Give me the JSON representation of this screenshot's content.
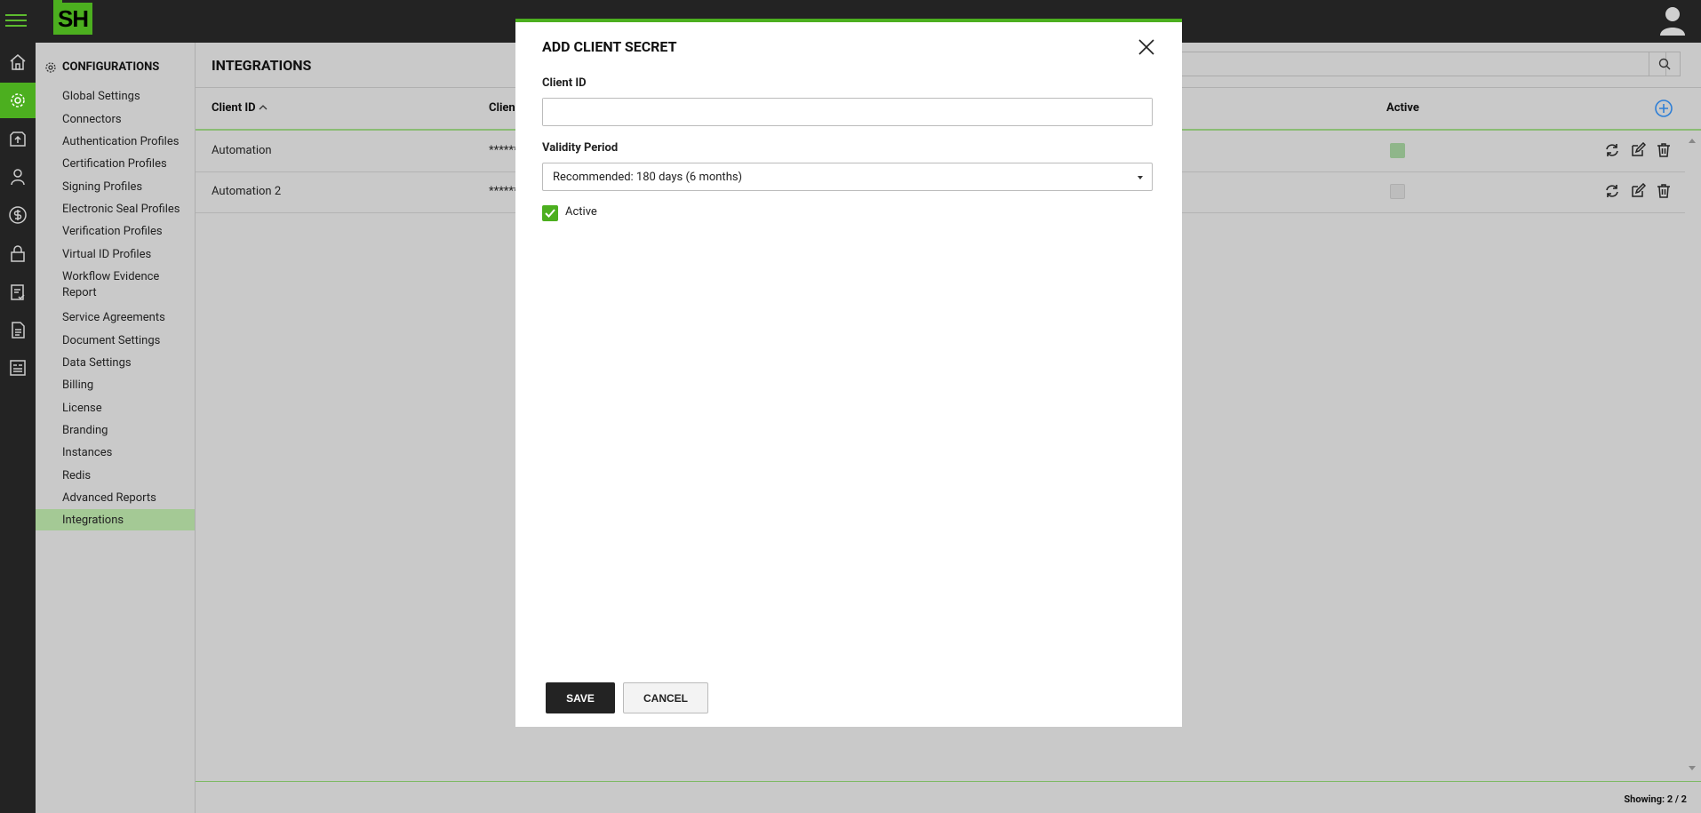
{
  "app": {
    "logo_text": "SH"
  },
  "sidebar": {
    "title": "CONFIGURATIONS",
    "items": [
      {
        "label": "Global Settings"
      },
      {
        "label": "Connectors"
      },
      {
        "label": "Authentication Profiles"
      },
      {
        "label": "Certification Profiles"
      },
      {
        "label": "Signing Profiles"
      },
      {
        "label": "Electronic Seal Profiles"
      },
      {
        "label": "Verification Profiles"
      },
      {
        "label": "Virtual ID Profiles"
      },
      {
        "label": "Workflow Evidence Report"
      },
      {
        "label": "Service Agreements"
      },
      {
        "label": "Document Settings"
      },
      {
        "label": "Data Settings"
      },
      {
        "label": "Billing"
      },
      {
        "label": "License"
      },
      {
        "label": "Branding"
      },
      {
        "label": "Instances"
      },
      {
        "label": "Redis"
      },
      {
        "label": "Advanced Reports"
      },
      {
        "label": "Integrations"
      }
    ]
  },
  "main": {
    "title": "INTEGRATIONS",
    "search_placeholder": "Search",
    "columns": {
      "client_id": "Client ID",
      "client_secret": "Clien",
      "active": "Active"
    },
    "rows": [
      {
        "client_id": "Automation",
        "secret": "******",
        "active": true
      },
      {
        "client_id": "Automation 2",
        "secret": "******",
        "active": false
      }
    ],
    "footer": "Showing: 2 / 2"
  },
  "dialog": {
    "title": "ADD CLIENT SECRET",
    "client_id_label": "Client ID",
    "client_id_value": "",
    "validity_label": "Validity Period",
    "validity_value": "Recommended: 180 days (6 months)",
    "active_label": "Active",
    "active_checked": true,
    "save_label": "SAVE",
    "cancel_label": "CANCEL"
  },
  "colors": {
    "accent": "#4caf1f",
    "topbar": "#232323",
    "overlay_bg": "#c9c9c9"
  },
  "icons": {
    "rail": [
      "home-icon",
      "settings-icon",
      "upload-icon",
      "users-icon",
      "dollar-icon",
      "lock-icon",
      "clipboard-check-icon",
      "document-icon",
      "report-icon"
    ]
  }
}
